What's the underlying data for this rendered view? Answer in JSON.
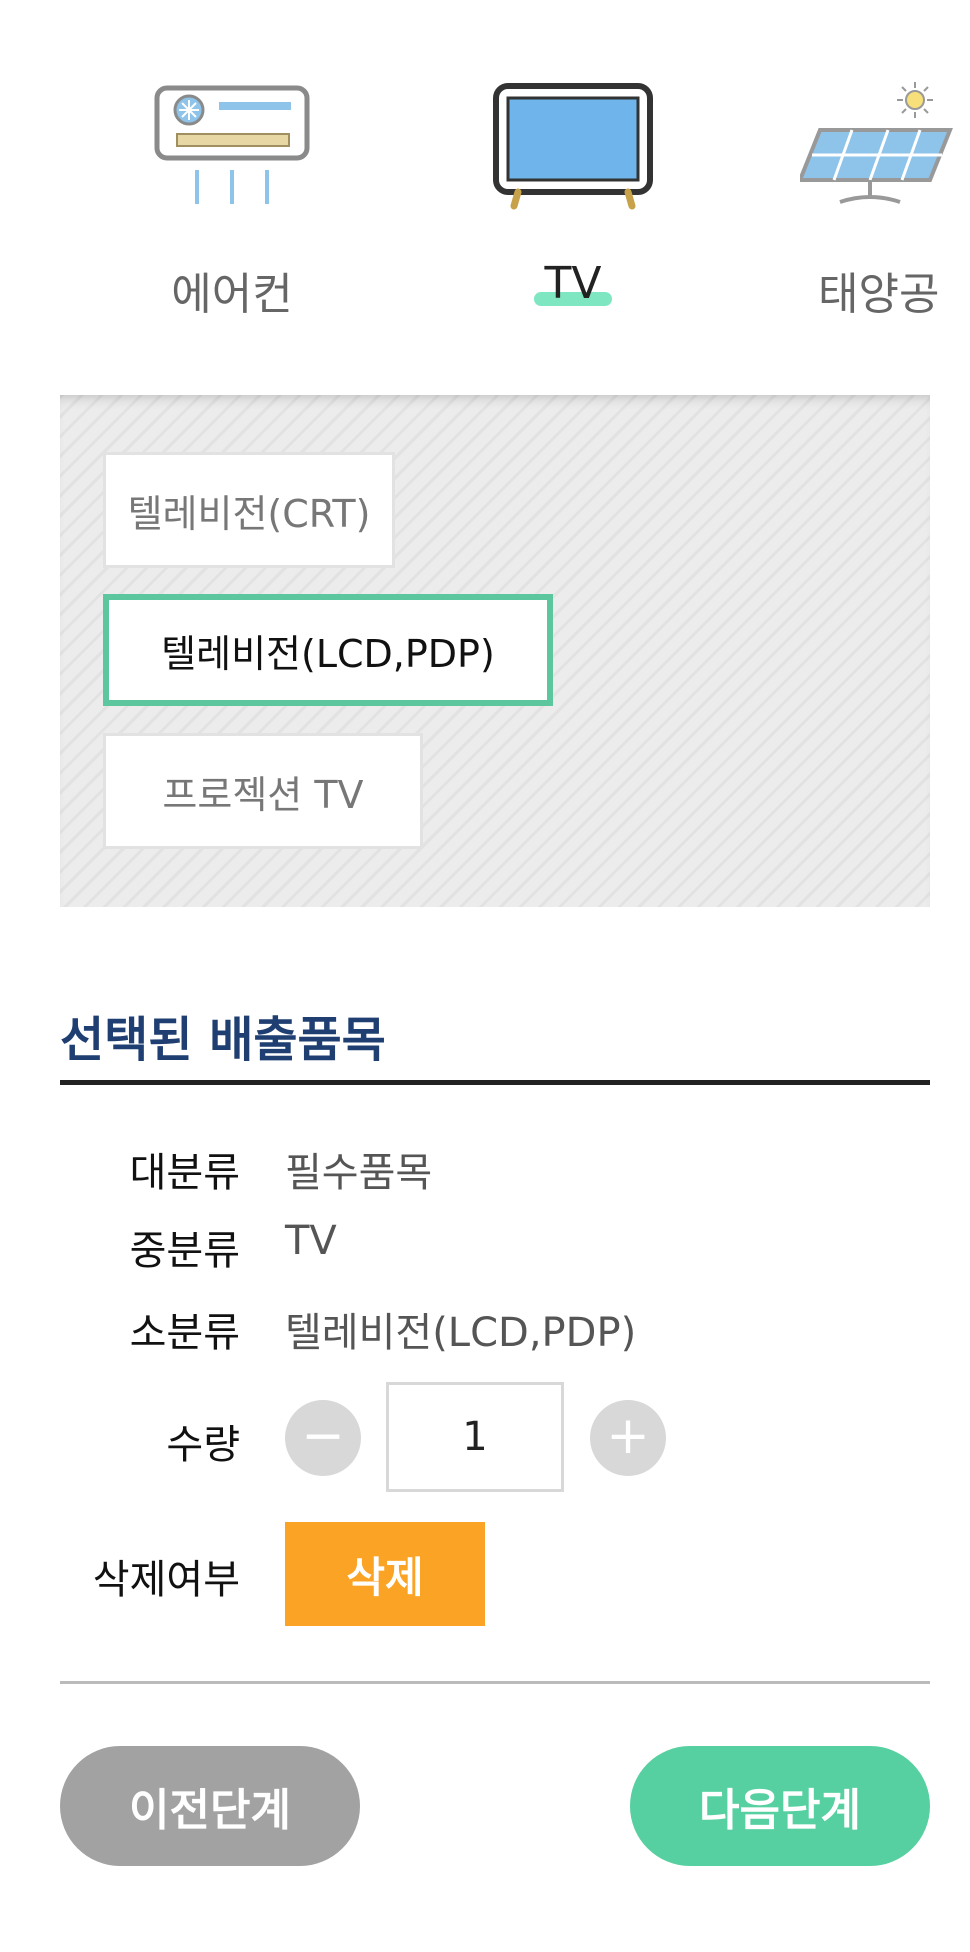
{
  "categories": [
    {
      "label": "에어컨",
      "icon": "air-conditioner-icon",
      "active": false
    },
    {
      "label": "TV",
      "icon": "tv-icon",
      "active": true
    },
    {
      "label": "태양공",
      "icon": "solar-panel-icon",
      "active": false
    }
  ],
  "subcategories": [
    {
      "label": "텔레비전(CRT)",
      "selected": false
    },
    {
      "label": "텔레비전(LCD,PDP)",
      "selected": true
    },
    {
      "label": "프로젝션 TV",
      "selected": false
    }
  ],
  "selected_section": {
    "title": "선택된 배출품목",
    "rows": {
      "major": {
        "label": "대분류",
        "value": "필수품목"
      },
      "middle": {
        "label": "중분류",
        "value": "TV"
      },
      "minor": {
        "label": "소분류",
        "value": "텔레비전(LCD,PDP)"
      }
    },
    "quantity": {
      "label": "수량",
      "value": "1",
      "minus": "−",
      "plus": "+"
    },
    "delete": {
      "label": "삭제여부",
      "button": "삭제"
    }
  },
  "nav": {
    "prev": "이전단계",
    "next": "다음단계"
  },
  "colors": {
    "accent_green": "#56d0a0",
    "tab_underline": "#7ee7c2",
    "selected_border": "#5cc79e",
    "delete_orange": "#fba325",
    "title_navy": "#1f3f72",
    "prev_gray": "#a2a2a2"
  }
}
